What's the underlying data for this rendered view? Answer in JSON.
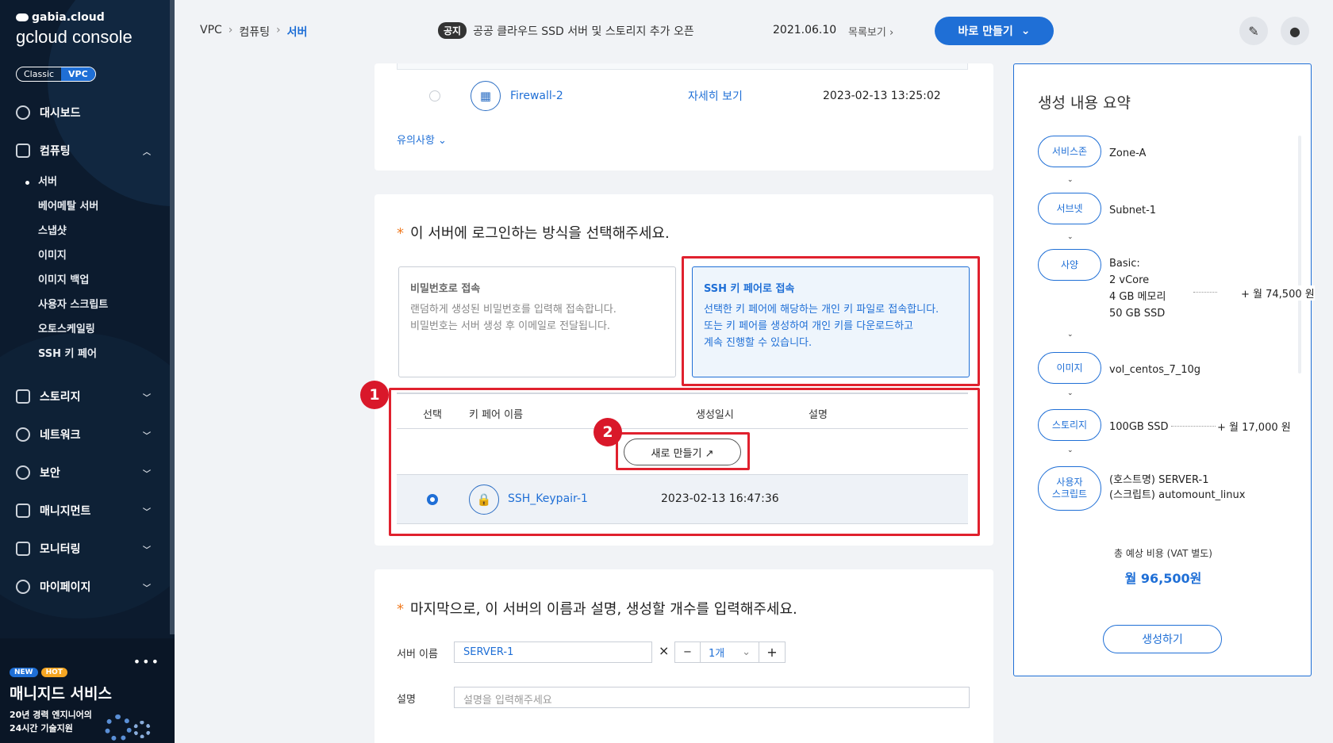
{
  "sidebar": {
    "brand_top": "gabia.cloud",
    "brand_main": "gcloud console",
    "mode_classic": "Classic",
    "mode_vpc": "VPC",
    "dashboard": "대시보드",
    "computing": "컴퓨팅",
    "computing_sub": [
      "서버",
      "베어메탈 서버",
      "스냅샷",
      "이미지",
      "이미지 백업",
      "사용자 스크립트",
      "오토스케일링",
      "SSH 키 페어"
    ],
    "storage": "스토리지",
    "network": "네트워크",
    "security": "보안",
    "management": "매니지먼트",
    "monitoring": "모니터링",
    "mypage": "마이페이지",
    "promo": {
      "tag_new": "NEW",
      "tag_hot": "HOT",
      "title": "매니지드 서비스",
      "desc1": "20년 경력 엔지니어의",
      "desc2": "24시간 기술지원"
    }
  },
  "header": {
    "breadcrumb": [
      "VPC",
      "컴퓨팅",
      "서버"
    ],
    "notice_badge": "공지",
    "notice_text": "공공 클라우드 SSD 서버 및 스토리지 추가 오픈",
    "notice_date": "2021.06.10",
    "notice_list": "목록보기",
    "quick_create": "바로 만들기"
  },
  "firewall": {
    "name": "Firewall-2",
    "detail": "자세히 보기",
    "created": "2023-02-13 13:25:02",
    "caution": "유의사항"
  },
  "login": {
    "question": "이 서버에 로그인하는 방식을 선택해주세요.",
    "password": {
      "title": "비밀번호로 접속",
      "desc1": "랜덤하게 생성된 비밀번호를 입력해 접속합니다.",
      "desc2": "비밀번호는 서버 생성 후 이메일로 전달됩니다."
    },
    "ssh": {
      "title": "SSH 키 페어로 접속",
      "desc1": "선택한 키 페어에 해당하는 개인 키 파일로 접속합니다.",
      "desc2": "또는 키 페어를 생성하여 개인 키를 다운로드하고",
      "desc3": "계속 진행할 수 있습니다."
    },
    "table": {
      "col_select": "선택",
      "col_name": "키 페어 이름",
      "col_created": "생성일시",
      "col_desc": "설명",
      "new_button": "새로 만들기 ↗",
      "row_name": "SSH_Keypair-1",
      "row_created": "2023-02-13 16:47:36"
    },
    "callout1": "1",
    "callout2": "2"
  },
  "final": {
    "question": "마지막으로, 이 서버의 이름과 설명, 생성할 개수를 입력해주세요.",
    "name_label": "서버 이름",
    "name_value": "SERVER-1",
    "times": "×",
    "count": "1개",
    "desc_label": "설명",
    "desc_placeholder": "설명을 입력해주세요"
  },
  "summary": {
    "title": "생성 내용 요약",
    "zone_label": "서비스존",
    "zone_value": "Zone-A",
    "subnet_label": "서브넷",
    "subnet_value": "Subnet-1",
    "spec_label": "사양",
    "spec_lines": [
      "Basic:",
      "2 vCore",
      "4 GB 메모리",
      "50 GB SSD"
    ],
    "spec_price": "+ 월 74,500 원",
    "image_label": "이미지",
    "image_value": "vol_centos_7_10g",
    "storage_label": "스토리지",
    "storage_value": "100GB SSD",
    "storage_price": "+ 월 17,000 원",
    "script_label1": "사용자",
    "script_label2": "스크립트",
    "script_line1": "(호스트명) SERVER-1",
    "script_line2": "(스크립트) automount_linux",
    "total_label": "총 예상 비용 (VAT 별도)",
    "total_value": "월 96,500원",
    "create_button": "생성하기"
  }
}
